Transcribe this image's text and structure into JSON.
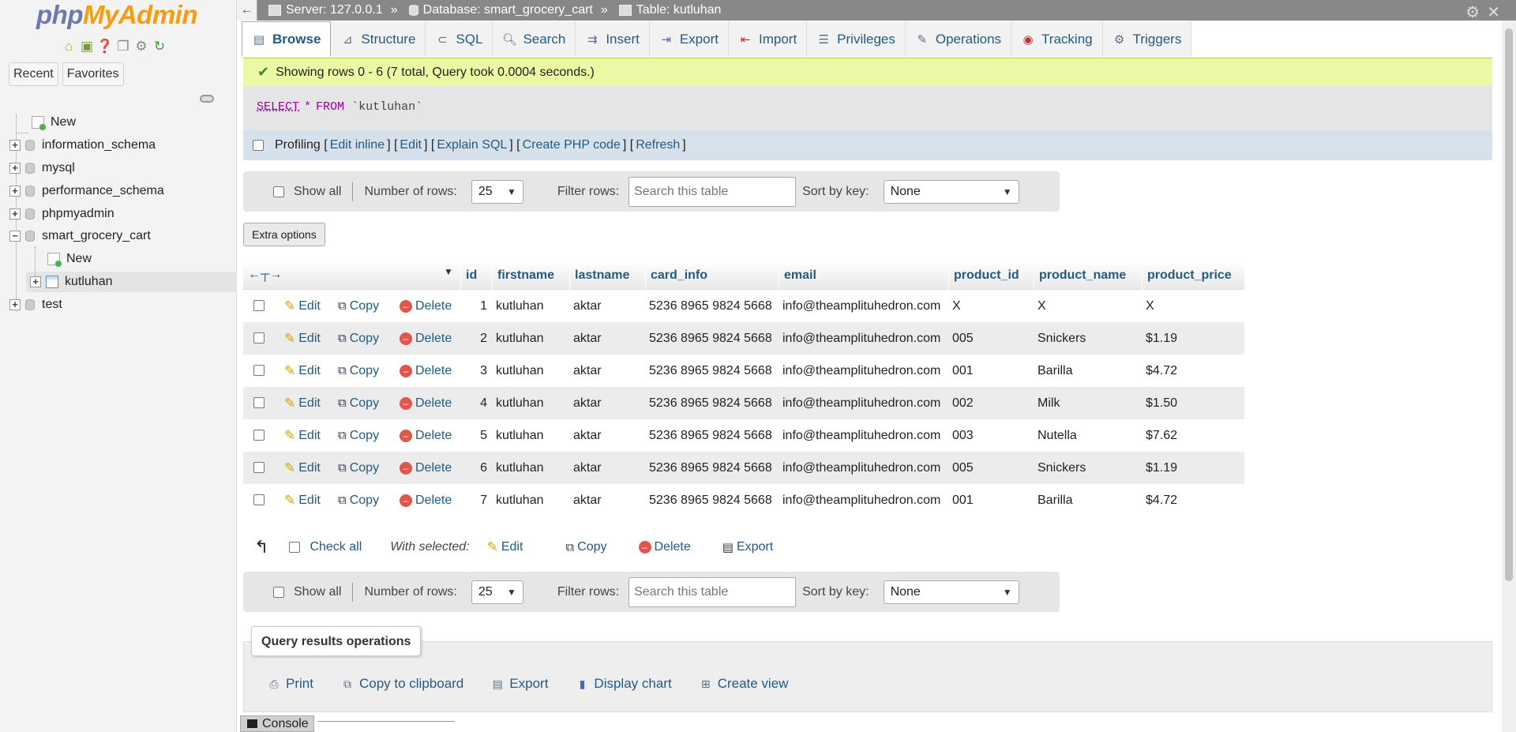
{
  "logo": {
    "part1": "php",
    "part2": "MyAdmin"
  },
  "sidebar": {
    "recent": "Recent",
    "favorites": "Favorites",
    "tree": {
      "new": "New",
      "information_schema": "information_schema",
      "mysql": "mysql",
      "performance_schema": "performance_schema",
      "phpmyadmin": "phpmyadmin",
      "smart_grocery_cart": "smart_grocery_cart",
      "sub_new": "New",
      "kutluhan": "kutluhan",
      "test": "test"
    }
  },
  "breadcrumb": {
    "server": "Server: 127.0.0.1",
    "database": "Database: smart_grocery_cart",
    "table": "Table: kutluhan",
    "separator": "»"
  },
  "tabs": [
    "Browse",
    "Structure",
    "SQL",
    "Search",
    "Insert",
    "Export",
    "Import",
    "Privileges",
    "Operations",
    "Tracking",
    "Triggers"
  ],
  "message": "Showing rows 0 - 6 (7 total, Query took 0.0004 seconds.)",
  "sql": {
    "select": "SELECT",
    "star": "*",
    "from": "FROM",
    "table": "`kutluhan`"
  },
  "profiling": {
    "label": "Profiling",
    "links": [
      "Edit inline",
      "Edit",
      "Explain SQL",
      "Create PHP code",
      "Refresh"
    ]
  },
  "navbar": {
    "show_all": "Show all",
    "number_of_rows": "Number of rows:",
    "rows_value": "25",
    "filter_rows": "Filter rows:",
    "filter_placeholder": "Search this table",
    "sort_by_key": "Sort by key:",
    "sort_value": "None"
  },
  "extra_options": "Extra options",
  "table": {
    "columns": [
      "id",
      "firstname",
      "lastname",
      "card_info",
      "email",
      "product_id",
      "product_name",
      "product_price"
    ],
    "actions": {
      "edit": "Edit",
      "copy": "Copy",
      "delete": "Delete"
    },
    "rows": [
      [
        "1",
        "kutluhan",
        "aktar",
        "5236 8965 9824 5668",
        "info@theamplituhedron.com",
        "X",
        "X",
        "X"
      ],
      [
        "2",
        "kutluhan",
        "aktar",
        "5236 8965 9824 5668",
        "info@theamplituhedron.com",
        "005",
        "Snickers",
        "$1.19"
      ],
      [
        "3",
        "kutluhan",
        "aktar",
        "5236 8965 9824 5668",
        "info@theamplituhedron.com",
        "001",
        "Barilla",
        "$4.72"
      ],
      [
        "4",
        "kutluhan",
        "aktar",
        "5236 8965 9824 5668",
        "info@theamplituhedron.com",
        "002",
        "Milk",
        "$1.50"
      ],
      [
        "5",
        "kutluhan",
        "aktar",
        "5236 8965 9824 5668",
        "info@theamplituhedron.com",
        "003",
        "Nutella",
        "$7.62"
      ],
      [
        "6",
        "kutluhan",
        "aktar",
        "5236 8965 9824 5668",
        "info@theamplituhedron.com",
        "005",
        "Snickers",
        "$1.19"
      ],
      [
        "7",
        "kutluhan",
        "aktar",
        "5236 8965 9824 5668",
        "info@theamplituhedron.com",
        "001",
        "Barilla",
        "$4.72"
      ]
    ]
  },
  "with_selected": {
    "check_all": "Check all",
    "label": "With selected:",
    "edit": "Edit",
    "copy": "Copy",
    "delete": "Delete",
    "export": "Export"
  },
  "query_ops": {
    "title": "Query results operations",
    "print": "Print",
    "copy_clipboard": "Copy to clipboard",
    "export": "Export",
    "display_chart": "Display chart",
    "create_view": "Create view"
  },
  "console": "Console"
}
